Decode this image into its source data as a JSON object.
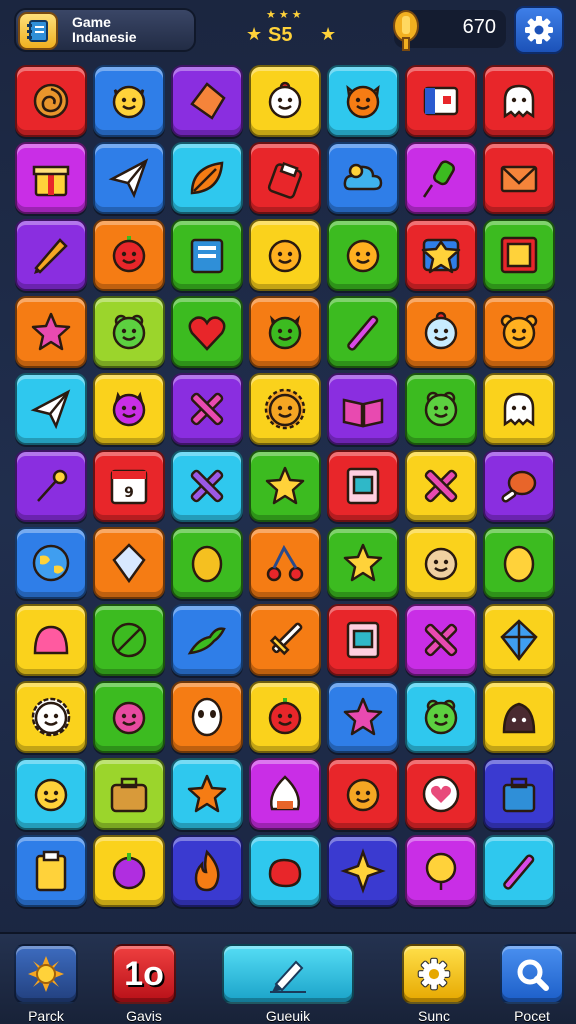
{
  "header": {
    "title_line1": "Game",
    "title_line2": "Indanesie",
    "star_value": "S5",
    "coins": "670"
  },
  "colors": {
    "red": "#e8262a",
    "blue": "#2f7ee8",
    "purple": "#8a2ee0",
    "yellow": "#fad21c",
    "cyan": "#2fc8ee",
    "orange": "#f57c14",
    "green": "#3cbb20",
    "magenta": "#c92ee6",
    "indigo": "#3a3ad0",
    "lime": "#9bd52c"
  },
  "tiles": [
    [
      {
        "color": "red",
        "icon": "swirl-cookie-icon"
      },
      {
        "color": "blue",
        "icon": "cat-face-icon"
      },
      {
        "color": "purple",
        "icon": "orange-diamond-icon"
      },
      {
        "color": "yellow",
        "icon": "chick-face-icon"
      },
      {
        "color": "cyan",
        "icon": "fox-face-icon"
      },
      {
        "color": "red",
        "icon": "flag-card-icon"
      },
      {
        "color": "red",
        "icon": "ghost-face-icon"
      }
    ],
    [
      {
        "color": "magenta",
        "icon": "gift-box-icon"
      },
      {
        "color": "blue",
        "icon": "paper-plane-icon"
      },
      {
        "color": "cyan",
        "icon": "leaf-icon"
      },
      {
        "color": "red",
        "icon": "fuel-can-icon"
      },
      {
        "color": "blue",
        "icon": "cloud-icon"
      },
      {
        "color": "magenta",
        "icon": "push-pin-icon"
      },
      {
        "color": "red",
        "icon": "envelope-icon"
      }
    ],
    [
      {
        "color": "purple",
        "icon": "pencil-icon"
      },
      {
        "color": "orange",
        "icon": "apple-face-icon"
      },
      {
        "color": "green",
        "icon": "book-icon"
      },
      {
        "color": "yellow",
        "icon": "smiley-face-icon"
      },
      {
        "color": "green",
        "icon": "smiley-face-icon"
      },
      {
        "color": "red",
        "icon": "star-badge-icon"
      },
      {
        "color": "green",
        "icon": "picture-frame-icon"
      }
    ],
    [
      {
        "color": "orange",
        "icon": "pink-star-icon"
      },
      {
        "color": "lime",
        "icon": "frog-face-icon"
      },
      {
        "color": "green",
        "icon": "heart-icon"
      },
      {
        "color": "orange",
        "icon": "green-monster-icon"
      },
      {
        "color": "green",
        "icon": "wand-icon"
      },
      {
        "color": "orange",
        "icon": "blue-ghost-icon"
      },
      {
        "color": "orange",
        "icon": "bear-face-icon"
      }
    ],
    [
      {
        "color": "cyan",
        "icon": "paper-plane-icon"
      },
      {
        "color": "yellow",
        "icon": "purple-blob-icon"
      },
      {
        "color": "purple",
        "icon": "cross-tools-icon"
      },
      {
        "color": "yellow",
        "icon": "sun-face-icon"
      },
      {
        "color": "purple",
        "icon": "open-book-icon"
      },
      {
        "color": "green",
        "icon": "frog-face-icon"
      },
      {
        "color": "yellow",
        "icon": "ghost-face-icon"
      }
    ],
    [
      {
        "color": "purple",
        "icon": "magic-wand-icon"
      },
      {
        "color": "red",
        "icon": "calendar-icon"
      },
      {
        "color": "cyan",
        "icon": "cross-star-icon"
      },
      {
        "color": "green",
        "icon": "star-icon"
      },
      {
        "color": "red",
        "icon": "card-icon"
      },
      {
        "color": "yellow",
        "icon": "cross-tools-icon"
      },
      {
        "color": "purple",
        "icon": "chicken-leg-icon"
      }
    ],
    [
      {
        "color": "blue",
        "icon": "globe-icon"
      },
      {
        "color": "orange",
        "icon": "gem-icon"
      },
      {
        "color": "green",
        "icon": "lemon-icon"
      },
      {
        "color": "orange",
        "icon": "cherries-icon"
      },
      {
        "color": "green",
        "icon": "star-icon"
      },
      {
        "color": "yellow",
        "icon": "bun-face-icon"
      },
      {
        "color": "green",
        "icon": "egg-icon"
      }
    ],
    [
      {
        "color": "yellow",
        "icon": "jelly-icon"
      },
      {
        "color": "green",
        "icon": "leaf-ball-icon"
      },
      {
        "color": "blue",
        "icon": "dragon-icon"
      },
      {
        "color": "orange",
        "icon": "sword-icon"
      },
      {
        "color": "red",
        "icon": "card-icon"
      },
      {
        "color": "magenta",
        "icon": "cross-tools-icon"
      },
      {
        "color": "yellow",
        "icon": "kite-icon"
      }
    ],
    [
      {
        "color": "yellow",
        "icon": "sheep-face-icon"
      },
      {
        "color": "green",
        "icon": "pink-monster-icon"
      },
      {
        "color": "orange",
        "icon": "mask-icon"
      },
      {
        "color": "yellow",
        "icon": "tomato-icon"
      },
      {
        "color": "blue",
        "icon": "pink-star-icon"
      },
      {
        "color": "cyan",
        "icon": "frog-face-icon"
      },
      {
        "color": "yellow",
        "icon": "dark-blob-icon"
      }
    ],
    [
      {
        "color": "cyan",
        "icon": "bird-icon"
      },
      {
        "color": "lime",
        "icon": "briefcase-icon"
      },
      {
        "color": "cyan",
        "icon": "orange-star-icon"
      },
      {
        "color": "magenta",
        "icon": "rice-ball-icon"
      },
      {
        "color": "red",
        "icon": "orange-face-icon"
      },
      {
        "color": "red",
        "icon": "heart-bubble-icon"
      },
      {
        "color": "indigo",
        "icon": "bag-icon"
      }
    ],
    [
      {
        "color": "blue",
        "icon": "clipboard-icon"
      },
      {
        "color": "yellow",
        "icon": "plum-icon"
      },
      {
        "color": "indigo",
        "icon": "flame-icon"
      },
      {
        "color": "cyan",
        "icon": "boxing-glove-icon"
      },
      {
        "color": "indigo",
        "icon": "sparkle-star-icon"
      },
      {
        "color": "magenta",
        "icon": "balloon-icon"
      },
      {
        "color": "cyan",
        "icon": "wand-icon"
      }
    ]
  ],
  "bottom_nav": [
    {
      "label": "Parck",
      "icon": "sun-gear-icon",
      "color": "#2f5aa8"
    },
    {
      "label": "Gavis",
      "badge": "1o",
      "color": "#e8262a"
    },
    {
      "label": "Gueuik",
      "icon": "brush-icon",
      "color": "#2fc8ee"
    },
    {
      "label": "Sunc",
      "icon": "gear-icon",
      "color": "#fad21c"
    },
    {
      "label": "Pocet",
      "icon": "search-icon",
      "color": "#2f7ee8"
    }
  ]
}
